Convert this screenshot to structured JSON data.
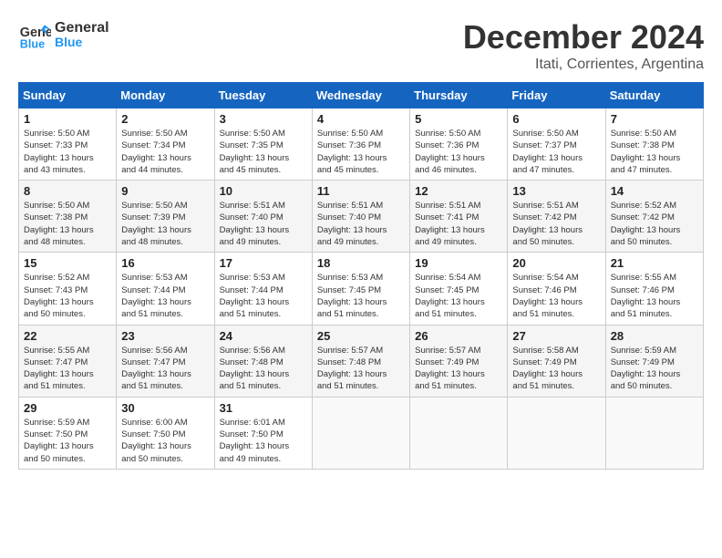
{
  "header": {
    "logo_line1": "General",
    "logo_line2": "Blue",
    "month": "December 2024",
    "location": "Itati, Corrientes, Argentina"
  },
  "weekdays": [
    "Sunday",
    "Monday",
    "Tuesday",
    "Wednesday",
    "Thursday",
    "Friday",
    "Saturday"
  ],
  "weeks": [
    [
      {
        "day": "1",
        "info": "Sunrise: 5:50 AM\nSunset: 7:33 PM\nDaylight: 13 hours\nand 43 minutes."
      },
      {
        "day": "2",
        "info": "Sunrise: 5:50 AM\nSunset: 7:34 PM\nDaylight: 13 hours\nand 44 minutes."
      },
      {
        "day": "3",
        "info": "Sunrise: 5:50 AM\nSunset: 7:35 PM\nDaylight: 13 hours\nand 45 minutes."
      },
      {
        "day": "4",
        "info": "Sunrise: 5:50 AM\nSunset: 7:36 PM\nDaylight: 13 hours\nand 45 minutes."
      },
      {
        "day": "5",
        "info": "Sunrise: 5:50 AM\nSunset: 7:36 PM\nDaylight: 13 hours\nand 46 minutes."
      },
      {
        "day": "6",
        "info": "Sunrise: 5:50 AM\nSunset: 7:37 PM\nDaylight: 13 hours\nand 47 minutes."
      },
      {
        "day": "7",
        "info": "Sunrise: 5:50 AM\nSunset: 7:38 PM\nDaylight: 13 hours\nand 47 minutes."
      }
    ],
    [
      {
        "day": "8",
        "info": "Sunrise: 5:50 AM\nSunset: 7:38 PM\nDaylight: 13 hours\nand 48 minutes."
      },
      {
        "day": "9",
        "info": "Sunrise: 5:50 AM\nSunset: 7:39 PM\nDaylight: 13 hours\nand 48 minutes."
      },
      {
        "day": "10",
        "info": "Sunrise: 5:51 AM\nSunset: 7:40 PM\nDaylight: 13 hours\nand 49 minutes."
      },
      {
        "day": "11",
        "info": "Sunrise: 5:51 AM\nSunset: 7:40 PM\nDaylight: 13 hours\nand 49 minutes."
      },
      {
        "day": "12",
        "info": "Sunrise: 5:51 AM\nSunset: 7:41 PM\nDaylight: 13 hours\nand 49 minutes."
      },
      {
        "day": "13",
        "info": "Sunrise: 5:51 AM\nSunset: 7:42 PM\nDaylight: 13 hours\nand 50 minutes."
      },
      {
        "day": "14",
        "info": "Sunrise: 5:52 AM\nSunset: 7:42 PM\nDaylight: 13 hours\nand 50 minutes."
      }
    ],
    [
      {
        "day": "15",
        "info": "Sunrise: 5:52 AM\nSunset: 7:43 PM\nDaylight: 13 hours\nand 50 minutes."
      },
      {
        "day": "16",
        "info": "Sunrise: 5:53 AM\nSunset: 7:44 PM\nDaylight: 13 hours\nand 51 minutes."
      },
      {
        "day": "17",
        "info": "Sunrise: 5:53 AM\nSunset: 7:44 PM\nDaylight: 13 hours\nand 51 minutes."
      },
      {
        "day": "18",
        "info": "Sunrise: 5:53 AM\nSunset: 7:45 PM\nDaylight: 13 hours\nand 51 minutes."
      },
      {
        "day": "19",
        "info": "Sunrise: 5:54 AM\nSunset: 7:45 PM\nDaylight: 13 hours\nand 51 minutes."
      },
      {
        "day": "20",
        "info": "Sunrise: 5:54 AM\nSunset: 7:46 PM\nDaylight: 13 hours\nand 51 minutes."
      },
      {
        "day": "21",
        "info": "Sunrise: 5:55 AM\nSunset: 7:46 PM\nDaylight: 13 hours\nand 51 minutes."
      }
    ],
    [
      {
        "day": "22",
        "info": "Sunrise: 5:55 AM\nSunset: 7:47 PM\nDaylight: 13 hours\nand 51 minutes."
      },
      {
        "day": "23",
        "info": "Sunrise: 5:56 AM\nSunset: 7:47 PM\nDaylight: 13 hours\nand 51 minutes."
      },
      {
        "day": "24",
        "info": "Sunrise: 5:56 AM\nSunset: 7:48 PM\nDaylight: 13 hours\nand 51 minutes."
      },
      {
        "day": "25",
        "info": "Sunrise: 5:57 AM\nSunset: 7:48 PM\nDaylight: 13 hours\nand 51 minutes."
      },
      {
        "day": "26",
        "info": "Sunrise: 5:57 AM\nSunset: 7:49 PM\nDaylight: 13 hours\nand 51 minutes."
      },
      {
        "day": "27",
        "info": "Sunrise: 5:58 AM\nSunset: 7:49 PM\nDaylight: 13 hours\nand 51 minutes."
      },
      {
        "day": "28",
        "info": "Sunrise: 5:59 AM\nSunset: 7:49 PM\nDaylight: 13 hours\nand 50 minutes."
      }
    ],
    [
      {
        "day": "29",
        "info": "Sunrise: 5:59 AM\nSunset: 7:50 PM\nDaylight: 13 hours\nand 50 minutes."
      },
      {
        "day": "30",
        "info": "Sunrise: 6:00 AM\nSunset: 7:50 PM\nDaylight: 13 hours\nand 50 minutes."
      },
      {
        "day": "31",
        "info": "Sunrise: 6:01 AM\nSunset: 7:50 PM\nDaylight: 13 hours\nand 49 minutes."
      },
      {
        "day": "",
        "info": ""
      },
      {
        "day": "",
        "info": ""
      },
      {
        "day": "",
        "info": ""
      },
      {
        "day": "",
        "info": ""
      }
    ]
  ]
}
